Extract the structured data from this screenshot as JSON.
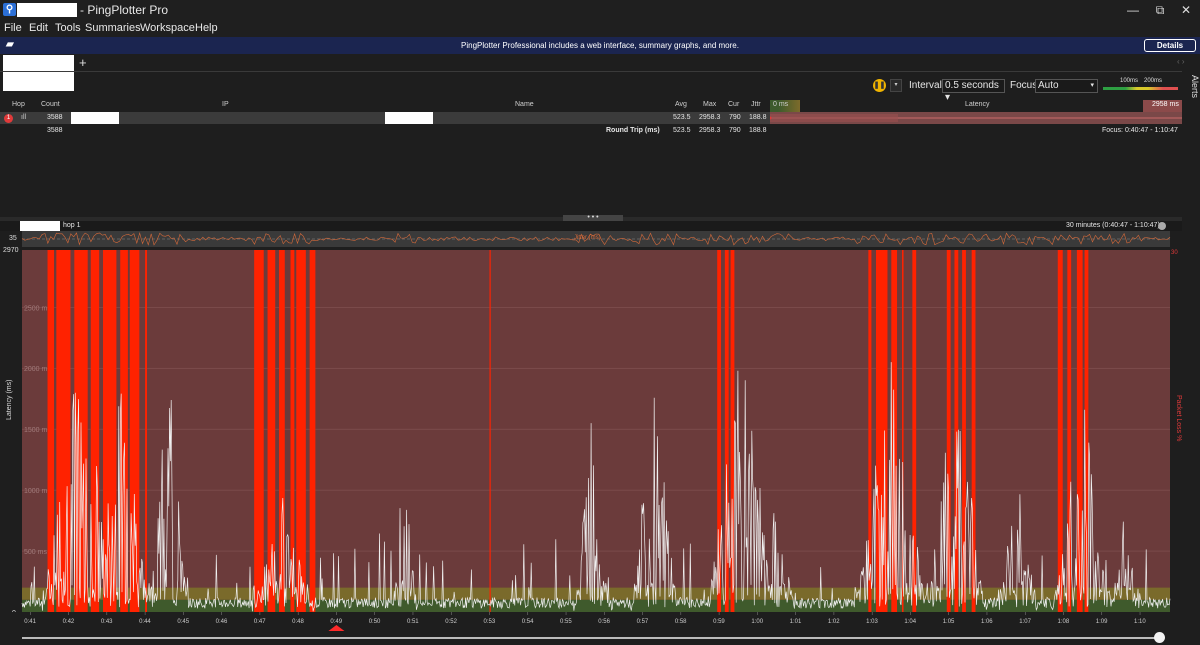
{
  "window": {
    "title_suffix": "- PingPlotter Pro",
    "minimize": "—",
    "maximize": "⧉",
    "close": "✕"
  },
  "menu": [
    "File",
    "Edit",
    "Tools",
    "Summaries",
    "Workspace",
    "Help"
  ],
  "banner": {
    "text": "PingPlotter Professional includes a web interface, summary graphs, and more.",
    "details": "Details"
  },
  "tabs": {
    "add": "+",
    "arrows": "‹ ›"
  },
  "toolbar": {
    "interval_label": "Interval",
    "interval_value": "0.5 seconds ▾",
    "focus_label": "Focus",
    "focus_value": "Auto",
    "scale_100": "100ms",
    "scale_200": "200ms",
    "alerts": "Alerts"
  },
  "table": {
    "headers": {
      "hop": "Hop",
      "count": "Count",
      "ip": "IP",
      "name": "Name",
      "avg": "Avg",
      "max": "Max",
      "cur": "Cur",
      "jttr": "Jttr",
      "latency": "Latency",
      "lat_min": "0 ms",
      "lat_max": "2958 ms"
    },
    "row": {
      "hop": "1",
      "count": "3588",
      "avg": "523.5",
      "max": "2958.3",
      "cur": "790",
      "jttr": "188.8"
    },
    "summary": {
      "count": "3588",
      "label": "Round Trip (ms)",
      "avg": "523.5",
      "max": "2958.3",
      "cur": "790",
      "jttr": "188.8",
      "focus": "Focus: 0:40:47 - 1:10:47"
    }
  },
  "graph": {
    "hop_label": "hop 1",
    "range": "30 minutes (0:40:47 - 1:10:47)",
    "divider": "• • •"
  },
  "chart_data": {
    "type": "line",
    "title": "",
    "ylabel": "Latency (ms)",
    "y2label": "Packet Loss %",
    "jitter_label": "Jitter (ms)",
    "jitter_scale": 35,
    "ylim": [
      0,
      2970
    ],
    "y_ticks": [
      0,
      500,
      1000,
      1500,
      2000,
      2500
    ],
    "y_tick_labels": [
      "0",
      "500 ms",
      "1000 ms",
      "1500 ms",
      "2000 ms",
      "2500 ms"
    ],
    "y_top_label": "2970",
    "y2_top_label": "30",
    "x_ticks": [
      "0:41",
      "0:42",
      "0:43",
      "0:44",
      "0:45",
      "0:46",
      "0:47",
      "0:48",
      "0:49",
      "0:50",
      "0:51",
      "0:52",
      "0:53",
      "0:54",
      "0:55",
      "0:56",
      "0:57",
      "0:58",
      "0:59",
      "1:00",
      "1:01",
      "1:02",
      "1:03",
      "1:04",
      "1:05",
      "1:06",
      "1:07",
      "1:08",
      "1:09",
      "1:10"
    ],
    "x_start_minutes": 40.783,
    "x_end_minutes": 70.783,
    "highlight_tick": "0:49",
    "loss_bands_minutes": [
      [
        41.45,
        41.62
      ],
      [
        41.68,
        42.05
      ],
      [
        42.15,
        42.5
      ],
      [
        42.58,
        42.8
      ],
      [
        42.9,
        43.25
      ],
      [
        43.35,
        43.55
      ],
      [
        43.6,
        43.85
      ],
      [
        44.0,
        44.05
      ],
      [
        46.85,
        47.1
      ],
      [
        47.2,
        47.4
      ],
      [
        47.5,
        47.65
      ],
      [
        47.8,
        47.9
      ],
      [
        47.95,
        48.2
      ],
      [
        48.3,
        48.45
      ],
      [
        53.0,
        53.03
      ],
      [
        58.95,
        59.05
      ],
      [
        59.15,
        59.25
      ],
      [
        59.3,
        59.4
      ],
      [
        62.9,
        62.98
      ],
      [
        63.1,
        63.4
      ],
      [
        63.5,
        63.65
      ],
      [
        63.78,
        63.82
      ],
      [
        64.05,
        64.15
      ],
      [
        64.95,
        65.05
      ],
      [
        65.15,
        65.25
      ],
      [
        65.35,
        65.45
      ],
      [
        65.6,
        65.7
      ],
      [
        67.85,
        67.98
      ],
      [
        68.1,
        68.2
      ],
      [
        68.35,
        68.5
      ],
      [
        68.55,
        68.65
      ]
    ],
    "bands": {
      "good_ms": 100,
      "warn_ms": 200
    },
    "colors": {
      "plot_bg": "#6b3b3b",
      "good": "#3f5a2c",
      "warn": "#7a6a2b",
      "loss": "#ff2200",
      "line": "#f0f0f0",
      "jitter": "#d66a3a"
    }
  }
}
